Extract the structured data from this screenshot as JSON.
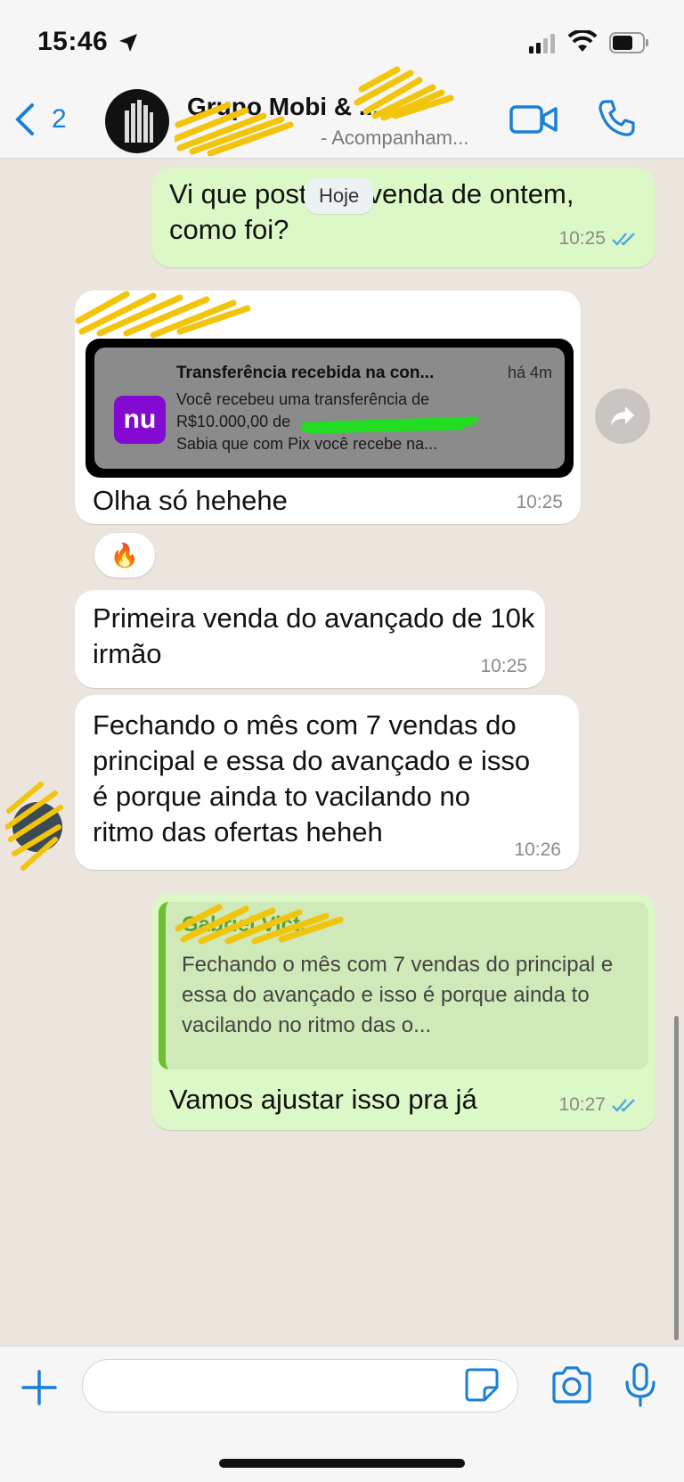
{
  "status_bar": {
    "time": "15:46"
  },
  "header": {
    "back_count": "2",
    "title": "Grupo Mobi & ...",
    "subtitle": "- Acompanham..."
  },
  "date_chip": "Hoje",
  "messages": [
    {
      "direction": "outgoing",
      "text": "Vi que postou a venda de ontem, como foi?",
      "time": "10:25",
      "read": true
    },
    {
      "direction": "incoming",
      "notification": {
        "app_icon_text": "nu",
        "title": "Transferência recebida na con...",
        "age": "há 4m",
        "line1": "Você recebeu uma transferência de",
        "line2": "R$10.000,00 de",
        "line3": "Sabia que com Pix você recebe na..."
      },
      "text": "Olha só hehehe",
      "time": "10:25",
      "reaction": "🔥"
    },
    {
      "direction": "incoming",
      "text": "Primeira venda do avançado de 10k irmão",
      "time": "10:25"
    },
    {
      "direction": "incoming",
      "text": "Fechando o mês com 7 vendas do principal e essa do avançado e isso é porque ainda to vacilando no ritmo das ofertas heheh",
      "time": "10:26"
    },
    {
      "direction": "outgoing",
      "quote": {
        "author": "Gabriel Vict.",
        "text": "Fechando o mês com 7 vendas do principal e essa do avançado e isso é porque ainda to vacilando no ritmo das o..."
      },
      "text": "Vamos ajustar isso pra já",
      "time": "10:27",
      "read": true
    }
  ],
  "colors": {
    "accent": "#1a7fd6",
    "outgoing_bubble": "#dcf8c6",
    "incoming_bubble": "#ffffff",
    "read_ticks": "#4fa8e8"
  }
}
